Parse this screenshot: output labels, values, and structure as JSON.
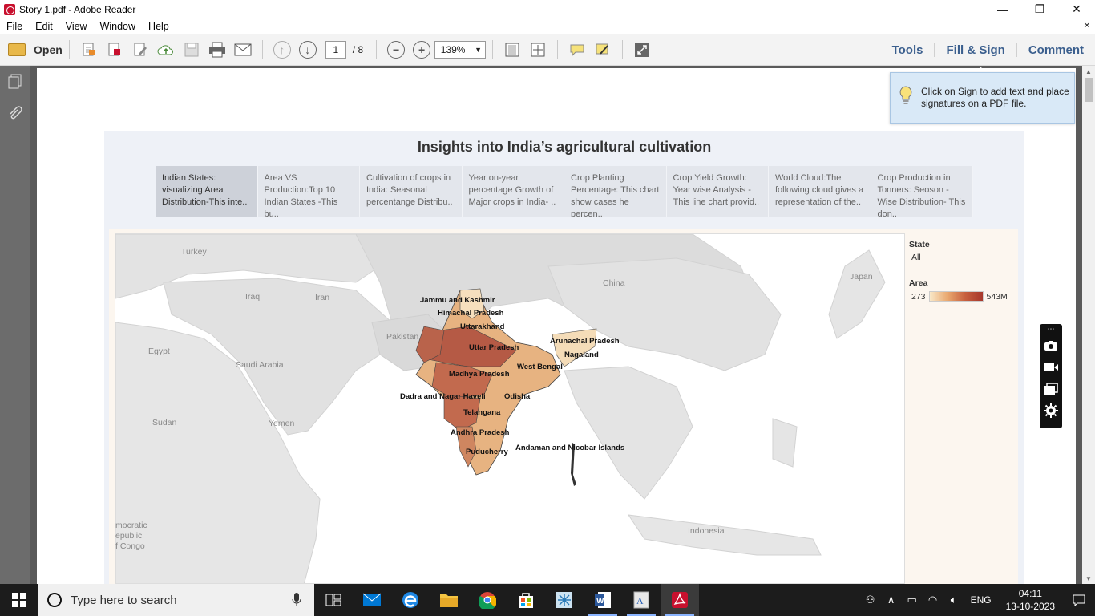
{
  "window": {
    "title": "Story 1.pdf - Adobe Reader",
    "minimize": "—",
    "restore": "❐",
    "close": "✕"
  },
  "menu": {
    "items": [
      "File",
      "Edit",
      "View",
      "Window",
      "Help"
    ],
    "close": "×"
  },
  "toolbar": {
    "open_label": "Open",
    "page_current": "1",
    "page_total": "/ 8",
    "zoom": "139%",
    "right": [
      "Tools",
      "Fill & Sign",
      "Comment"
    ]
  },
  "tip": {
    "text": "Click on Sign to add text and place signatures on a PDF file."
  },
  "story": {
    "title": "Insights into India’s agricultural cultivation",
    "tabs": [
      "Indian States: visualizing Area Distribution-This inte..",
      "Area VS Production:Top 10 Indian States -This bu..",
      "Cultivation of crops in India: Seasonal percentange Distribu..",
      "Year on-year percentage Growth of Major crops in India- ..",
      "Crop Planting Percentage: This chart show cases he percen..",
      "Crop Yield Growth: Year wise Analysis - This line chart provid..",
      "World Cloud:The following cloud gives a representation of the..",
      "Crop Production in Tonners: Seoson -Wise Distribution- This don.."
    ]
  },
  "legend": {
    "state_title": "State",
    "state_value": "All",
    "area_title": "Area",
    "area_min": "273",
    "area_max": "543M",
    "colors": [
      "#f9e8c8",
      "#e9a86f",
      "#c7603f",
      "#a6372c"
    ]
  },
  "map": {
    "countries": [
      "Turkey",
      "Iraq",
      "Iran",
      "Egypt",
      "Saudi Arabia",
      "Pakistan",
      "China",
      "Japan",
      "Sudan",
      "Yemen",
      "Indonesia",
      "mocratic",
      "epublic",
      "f Congo"
    ],
    "states": [
      "Jammu and Kashmir",
      "Himachal Pradesh",
      "Uttarakhand",
      "Uttar Pradesh",
      "Arunachal Pradesh",
      "Nagaland",
      "West Bengal",
      "Madhya Pradesh",
      "Dadra and Nagar Haveli",
      "Odisha",
      "Telangana",
      "Andhra Pradesh",
      "Andaman and Nicobar Islands",
      "Puducherry"
    ]
  },
  "taskbar": {
    "search_placeholder": "Type here to search",
    "language": "ENG",
    "time": "04:11",
    "date": "13-10-2023"
  }
}
